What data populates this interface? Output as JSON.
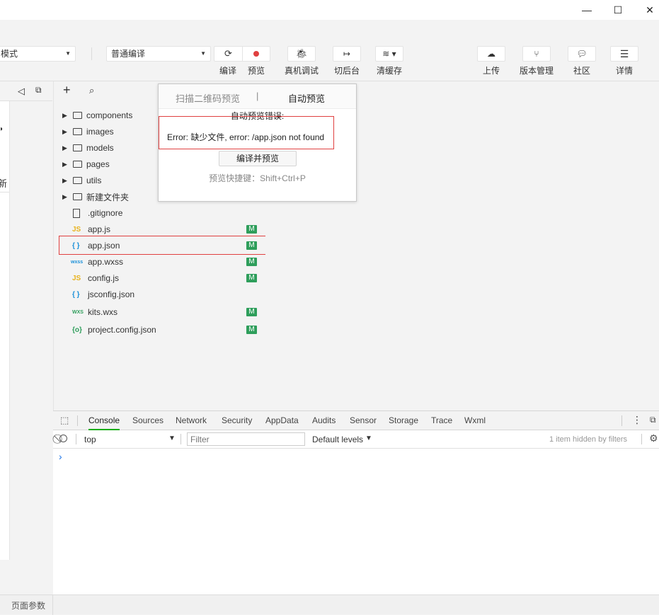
{
  "window": {
    "minimize_glyph": "—",
    "maximize_glyph": "☐",
    "close_glyph": "✕"
  },
  "toolbar": {
    "mode_select": "模式",
    "compile_select": "普通编译",
    "buttons": [
      {
        "label": "编译",
        "icon": "refresh-icon"
      },
      {
        "label": "预览",
        "icon": "preview-icon"
      },
      {
        "label": "真机调试",
        "icon": "bug-icon"
      },
      {
        "label": "切后台",
        "icon": "switch-background-icon"
      },
      {
        "label": "清缓存",
        "icon": "layers-icon"
      },
      {
        "label": "上传",
        "icon": "cloud-upload-icon"
      },
      {
        "label": "版本管理",
        "icon": "branch-icon"
      },
      {
        "label": "社区",
        "icon": "chat-icon"
      },
      {
        "label": "详情",
        "icon": "menu-icon"
      }
    ]
  },
  "left": {
    "partial_text": "新"
  },
  "filetree": {
    "items": [
      {
        "name": "components",
        "type": "folder",
        "badge": ""
      },
      {
        "name": "images",
        "type": "folder",
        "badge": ""
      },
      {
        "name": "models",
        "type": "folder",
        "badge": ""
      },
      {
        "name": "pages",
        "type": "folder",
        "badge": ""
      },
      {
        "name": "utils",
        "type": "folder",
        "badge": ""
      },
      {
        "name": "新建文件夹",
        "type": "folder",
        "badge": ""
      },
      {
        "name": ".gitignore",
        "type": "file",
        "icon_text": "",
        "badge": ""
      },
      {
        "name": "app.js",
        "type": "file",
        "icon_text": "JS",
        "badge": "M"
      },
      {
        "name": "app.json",
        "type": "file",
        "icon_text": "{ }",
        "badge": "M"
      },
      {
        "name": "app.wxss",
        "type": "file",
        "icon_text": "wxss",
        "badge": "M"
      },
      {
        "name": "config.js",
        "type": "file",
        "icon_text": "JS",
        "badge": "M"
      },
      {
        "name": "jsconfig.json",
        "type": "file",
        "icon_text": "{ }",
        "badge": ""
      },
      {
        "name": "kits.wxs",
        "type": "file",
        "icon_text": "WXS",
        "badge": "M"
      },
      {
        "name": "project.config.json",
        "type": "file",
        "icon_text": "{o}",
        "badge": "M"
      }
    ]
  },
  "popup": {
    "tab_qr": "扫描二维码预览",
    "tab_separator": "|",
    "tab_auto": "自动预览",
    "error_title": "自动预览错误:",
    "error_message": "Error: 缺少文件, error: /app.json not found",
    "compile_button": "编译并预览",
    "shortcut": "预览快捷键：Shift+Ctrl+P"
  },
  "devtools": {
    "tabs": [
      "Console",
      "Sources",
      "Network",
      "Security",
      "AppData",
      "Audits",
      "Sensor",
      "Storage",
      "Trace",
      "Wxml"
    ],
    "active_tab": "Console",
    "context": "top",
    "filter_placeholder": "Filter",
    "levels": "Default levels",
    "hidden_info": "1 item hidden by filters",
    "prompt": "›"
  },
  "statusbar": {
    "page_params": "页面参数"
  },
  "colors": {
    "badge": "#2e9e5b",
    "highlight": "#e04040",
    "js_icon": "#e8b21c",
    "json_icon": "#1a90d9",
    "active_tab": "#1aad19"
  }
}
